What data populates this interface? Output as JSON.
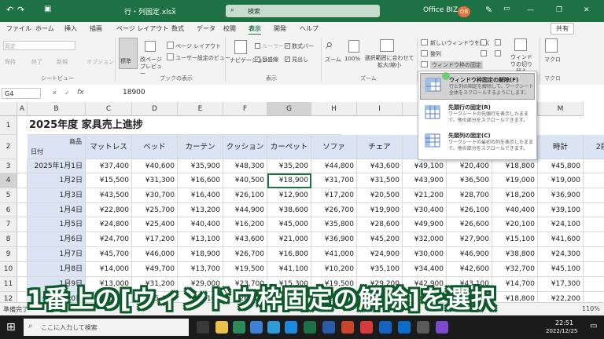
{
  "titlebar": {
    "filename": "行・列固定.xlsx",
    "dropdown_arrow": "⌄",
    "search_placeholder": "検索",
    "account_name": "Office BIZ",
    "avatar_initials": "OB",
    "minimize": "—",
    "restore": "❐",
    "close": "✕",
    "undo": "↶",
    "redo": "↷",
    "save": "▣"
  },
  "tabs": [
    "ファイル",
    "ホーム",
    "挿入",
    "描画",
    "ページ レイアウト",
    "数式",
    "データ",
    "校閲",
    "表示",
    "開発",
    "ヘルプ"
  ],
  "active_tab": "表示",
  "share_label": "共有",
  "ribbon": {
    "sheetview": {
      "default_label": "既定",
      "keep": "保持",
      "exit": "終了",
      "new": "新規",
      "options": "オプション",
      "group": "シートビュー"
    },
    "bookview": {
      "normal": "標準",
      "pagebreak": "改ページ プレビュー",
      "pagelayout": "ページ レイアウト",
      "custom": "ユーザー設定のビュー",
      "group": "ブックの表示"
    },
    "show": {
      "navigation": "ナビゲーション",
      "ruler": "ルーラー",
      "gridlines": "目盛線",
      "formulabar": "数式バー",
      "headings": "見出し",
      "group": "表示"
    },
    "zoom": {
      "zoom": "ズーム",
      "hundred": "100%",
      "fit": "選択範囲に合わせて拡大/縮小",
      "group": "ズーム"
    },
    "window": {
      "new_window": "新しいウィンドウを開く",
      "arrange": "整列",
      "freeze": "ウィンドウ枠の固定",
      "switch": "ウィンドウの切り替え"
    },
    "macro": {
      "label": "マクロ",
      "group": "マクロ"
    }
  },
  "formula_bar": {
    "namebox": "G4",
    "fx": "fx",
    "value": "18900"
  },
  "columns": [
    "A",
    "B",
    "C",
    "D",
    "E",
    "F",
    "G",
    "H",
    "I",
    "J",
    "K",
    "L",
    "M"
  ],
  "sheet": {
    "title": "2025年度 家具売上進捗",
    "corner_top": "商品",
    "corner_bottom": "日付",
    "products": [
      "マットレス",
      "ベッド",
      "カーテン",
      "クッション",
      "カーペット",
      "ソファ",
      "チェア",
      "デ",
      "",
      "",
      "時計",
      "2段"
    ],
    "rows": [
      {
        "row": "3",
        "date": "2025年1月1日",
        "values": [
          "¥37,400",
          "¥40,600",
          "¥35,900",
          "¥48,300",
          "¥35,200",
          "¥44,800",
          "¥43,600",
          "¥49,100",
          "¥20,400",
          "¥18,800",
          "¥45,800",
          ""
        ]
      },
      {
        "row": "4",
        "date": "1月2日",
        "values": [
          "¥15,500",
          "¥31,300",
          "¥16,600",
          "¥40,500",
          "¥18,900",
          "¥31,700",
          "¥31,500",
          "¥43,900",
          "¥36,500",
          "¥19,000",
          "¥19,000",
          ""
        ]
      },
      {
        "row": "5",
        "date": "1月3日",
        "values": [
          "¥43,500",
          "¥30,700",
          "¥16,400",
          "¥26,100",
          "¥12,900",
          "¥17,200",
          "¥20,500",
          "¥21,200",
          "¥28,700",
          "¥18,200",
          "¥36,900",
          ""
        ]
      },
      {
        "row": "6",
        "date": "1月4日",
        "values": [
          "¥22,800",
          "¥25,700",
          "¥13,200",
          "¥44,900",
          "¥38,600",
          "¥26,700",
          "¥19,900",
          "¥30,400",
          "¥26,100",
          "¥40,400",
          "¥39,100",
          ""
        ]
      },
      {
        "row": "7",
        "date": "1月5日",
        "values": [
          "¥24,800",
          "¥25,400",
          "¥40,400",
          "¥16,200",
          "¥45,000",
          "¥35,800",
          "¥28,600",
          "¥49,900",
          "¥26,600",
          "¥20,100",
          "¥24,100",
          ""
        ]
      },
      {
        "row": "8",
        "date": "1月6日",
        "values": [
          "¥24,700",
          "¥17,200",
          "¥13,100",
          "¥43,600",
          "¥21,000",
          "¥36,900",
          "¥45,200",
          "¥32,000",
          "¥27,900",
          "¥15,100",
          "¥41,600",
          ""
        ]
      },
      {
        "row": "9",
        "date": "1月7日",
        "values": [
          "¥45,700",
          "¥46,000",
          "¥18,900",
          "¥26,700",
          "¥16,800",
          "¥41,000",
          "¥24,900",
          "¥30,000",
          "¥46,900",
          "¥38,800",
          "¥24,300",
          ""
        ]
      },
      {
        "row": "10",
        "date": "1月8日",
        "values": [
          "¥14,000",
          "¥49,700",
          "¥13,700",
          "¥19,500",
          "¥41,100",
          "¥10,200",
          "¥35,100",
          "¥34,400",
          "¥42,600",
          "¥32,700",
          "¥45,100",
          ""
        ]
      },
      {
        "row": "11",
        "date": "1月9日",
        "values": [
          "¥13,000",
          "¥31,200",
          "¥29,000",
          "¥23,700",
          "¥15,300",
          "¥19,500",
          "¥29,200",
          "¥42,900",
          "¥43,100",
          "¥14,700",
          "¥17,300",
          ""
        ]
      },
      {
        "row": "12",
        "date": "1月10日",
        "values": [
          "¥30,000",
          "¥25,400",
          "¥22,100",
          "¥26,600",
          "¥23,300",
          "¥28,900",
          "¥10,700",
          "¥43,800",
          "¥20,900",
          "¥18,800",
          "¥22,200",
          ""
        ]
      },
      {
        "row": "13",
        "date": "",
        "values": [
          "",
          "",
          "",
          "",
          "",
          "",
          "",
          "",
          "",
          "",
          "",
          ""
        ]
      }
    ]
  },
  "dropdown": {
    "items": [
      {
        "title": "ウィンドウ枠固定の解除(F)",
        "desc": "行と列の固定を解除して、ワークシート全体をスクロールするようにします。"
      },
      {
        "title": "先頭行の固定(R)",
        "desc": "ワークシートの先頭行を表示したままで、他の部分をスクロールできます。"
      },
      {
        "title": "先頭列の固定(C)",
        "desc": "ワークシートの最初の列を表示したままで、他の部分をスクロールできます。"
      }
    ]
  },
  "caption": "1番上の[ウィンドウ枠固定の解除]を選択",
  "status": {
    "ready": "準備完了",
    "zoom": "110%"
  },
  "taskbar": {
    "search_placeholder": "ここに入力して検索",
    "time": "22:51",
    "date": "2022/12/25"
  },
  "colors": {
    "excel_green": "#1e7145",
    "header_blue": "#dbe4f3",
    "caption_outline": "#0d5a2a"
  }
}
